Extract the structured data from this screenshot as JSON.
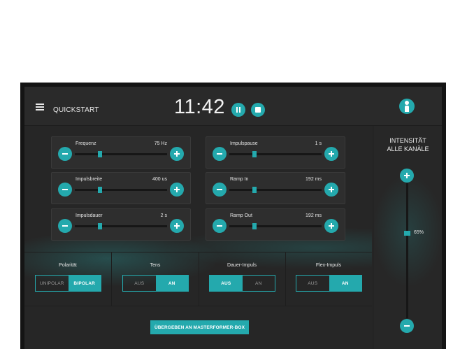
{
  "header": {
    "menu_icon": "hamburger-menu-icon",
    "title": "QUICKSTART",
    "clock": "11:42",
    "pause_icon": "pause-icon",
    "stop_icon": "stop-icon",
    "user_icon": "person-icon"
  },
  "params": [
    {
      "label": "Frequenz",
      "value": "75 Hz",
      "level": 0.27
    },
    {
      "label": "Impulsbreite",
      "value": "400 us",
      "level": 0.27
    },
    {
      "label": "Impulsdauer",
      "value": "2 s",
      "level": 0.27
    },
    {
      "label": "Impulspause",
      "value": "1 s",
      "level": 0.27
    },
    {
      "label": "Ramp In",
      "value": "192 ms",
      "level": 0.27
    },
    {
      "label": "Ramp Out",
      "value": "192 ms",
      "level": 0.27
    }
  ],
  "toggles": [
    {
      "title": "Polarität",
      "options": [
        "UNIPOLAR",
        "BIPOLAR"
      ],
      "active": 1
    },
    {
      "title": "Tens",
      "options": [
        "AUS",
        "AN"
      ],
      "active": 1
    },
    {
      "title": "Dauer-Impuls",
      "options": [
        "AUS",
        "AN"
      ],
      "active": 0
    },
    {
      "title": "Flex-Impuls",
      "options": [
        "AUS",
        "AN"
      ],
      "active": 1
    }
  ],
  "submit_label": "ÜBERGEBEN AN MASTERFORMER-BOX",
  "intensity": {
    "title_line1": "INTENSITÄT",
    "title_line2": "ALLE KANÄLE",
    "value": "65%",
    "level": 0.65
  },
  "colors": {
    "accent": "#24a9ad",
    "background": "#2a2a2a"
  }
}
